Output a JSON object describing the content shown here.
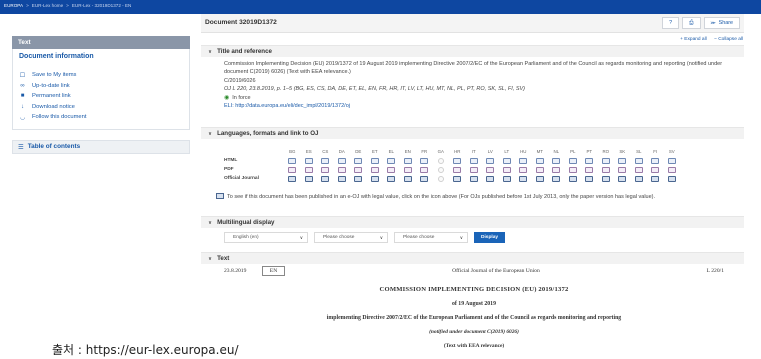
{
  "breadcrumb": {
    "items": [
      "EUROPA",
      "EUR-Lex home",
      "EUR-Lex - 32019D1372 - EN"
    ]
  },
  "document": {
    "title": "Document 32019D1372",
    "help_label": "?",
    "share_label": "Share",
    "expand_all": "+ Expand all",
    "collapse_all": "− Collapse all"
  },
  "sidebar": {
    "tab_label": "Text",
    "info_title": "Document information",
    "links": [
      {
        "label": "Save to My items",
        "icon": "save-icon",
        "glyph": "☐"
      },
      {
        "label": "Up-to-date link",
        "icon": "link-icon",
        "glyph": "∞"
      },
      {
        "label": "Permanent link",
        "icon": "bookmark-icon",
        "glyph": "■"
      },
      {
        "label": "Download notice",
        "icon": "download-icon",
        "glyph": "↓"
      },
      {
        "label": "Follow this document",
        "icon": "rss-icon",
        "glyph": "◡"
      }
    ],
    "toc_label": "Table of contents"
  },
  "title_section": {
    "heading": "Title and reference",
    "description": "Commission Implementing Decision (EU) 2019/1372 of 19 August 2019 implementing Directive 2007/2/EC of the European Parliament and of the Council as regards monitoring and reporting (notified under document C(2019) 6026) (Text with EEA relevance.)",
    "celex": "C/2019/6026",
    "oj_ref": "OJ L 220, 23.8.2019, p. 1–5 (BG, ES, CS, DA, DE, ET, EL, EN, FR, HR, IT, LV, LT, HU, MT, NL, PL, PT, RO, SK, SL, FI, SV)",
    "status": "In force",
    "eli": "ELI: http://data.europa.eu/eli/dec_impl/2019/1372/oj"
  },
  "languages_section": {
    "heading": "Languages, formats and link to OJ",
    "langs": [
      "BG",
      "ES",
      "CS",
      "DA",
      "DE",
      "ET",
      "EL",
      "EN",
      "FR",
      "GA",
      "HR",
      "IT",
      "LV",
      "LT",
      "HU",
      "MT",
      "NL",
      "PL",
      "PT",
      "RO",
      "SK",
      "SL",
      "FI",
      "SV"
    ],
    "row_labels": [
      "HTML",
      "PDF",
      "Official Journal"
    ],
    "unavailable_lang": "GA",
    "note": "To see if this document has been published in an e-OJ with legal value, click on the icon above (For OJs published before 1st July 2013, only the paper version has legal value)."
  },
  "multilingual_section": {
    "heading": "Multilingual display",
    "selects": [
      "English (en)",
      "Please choose",
      "Please choose"
    ],
    "display_button": "Display"
  },
  "text_section": {
    "heading": "Text",
    "date": "23.8.2019",
    "lang": "EN",
    "journal": "Official Journal of the European Union",
    "page": "L 220/1",
    "decision_title": "COMMISSION IMPLEMENTING DECISION (EU) 2019/1372",
    "decision_date": "of 19 August 2019",
    "implementing": "implementing Directive 2007/2/EC of the European Parliament and of the Council as regards monitoring and reporting",
    "notified": "(notified under document C(2019) 6026)",
    "eea": "(Text with EEA relevance)"
  },
  "source_caption": "출처 : https://eur-lex.europa.eu/"
}
